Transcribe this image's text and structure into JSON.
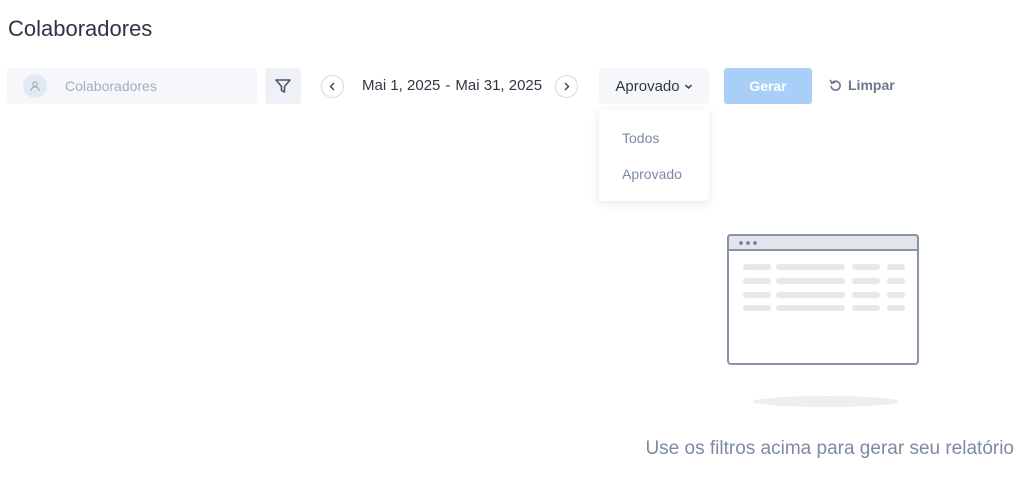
{
  "page": {
    "title": "Colaboradores"
  },
  "filters": {
    "employee_placeholder": "Colaboradores",
    "date_start": "Mai 1, 2025",
    "date_separator": "-",
    "date_end": "Mai 31, 2025",
    "status_selected": "Aprovado",
    "status_options": [
      "Todos",
      "Aprovado"
    ],
    "generate_label": "Gerar",
    "clear_label": "Limpar"
  },
  "empty_state": {
    "message": "Use os filtros acima para gerar seu relatório"
  },
  "icons": {
    "avatar": "user-icon",
    "filter": "filter-icon",
    "prev": "chevron-left-icon",
    "next": "chevron-right-icon",
    "status": "chevron-down-icon",
    "clear": "refresh-icon"
  },
  "colors": {
    "primary_disabled": "#a9cff8",
    "input_bg": "#f5f7fb",
    "muted_text": "#7d8aa3"
  }
}
